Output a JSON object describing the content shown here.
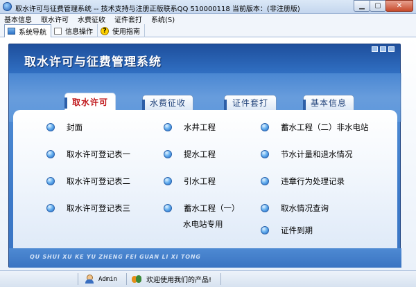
{
  "window": {
    "title": "取水许可与征费管理系统 -- 技术支持与注册正版联系QQ 510000118    当前版本：(非注册版)"
  },
  "menu": [
    "基本信息",
    "取水许可",
    "水费征收",
    "证件套打",
    "系统(S)"
  ],
  "toolbar": {
    "tabs": [
      {
        "label": "系统导航",
        "icon": "monitor-icon"
      },
      {
        "label": "信息操作",
        "icon": "document-icon"
      },
      {
        "label": "使用指南",
        "icon": "help-icon",
        "glyph": "?"
      }
    ]
  },
  "main": {
    "title": "取水许可与征费管理系统",
    "tabs": [
      "取水许可",
      "水费征收",
      "证件套打",
      "基本信息"
    ],
    "active_tab": "取水许可",
    "col1": [
      "封面",
      "取水许可登记表一",
      "取水许可登记表二",
      "取水许可登记表三"
    ],
    "col2": [
      "水井工程",
      "提水工程",
      "引水工程",
      "蓄水工程（一）"
    ],
    "col2_extra": "水电站专用",
    "col3": [
      "蓄水工程（二）非水电站",
      "节水计量和退水情况",
      "违章行为处理记录",
      "取水情况查询",
      "证件到期"
    ],
    "footer_text": "QU SHUI XU KE YU ZHENG FEI GUAN LI XI TONG"
  },
  "status": {
    "user": "Admin",
    "message": "欢迎使用我们的产品!"
  },
  "colors": {
    "frame_blue": "#2f6dc0",
    "active_tab_text": "#c0161a",
    "tab_text": "#1c3f78"
  }
}
